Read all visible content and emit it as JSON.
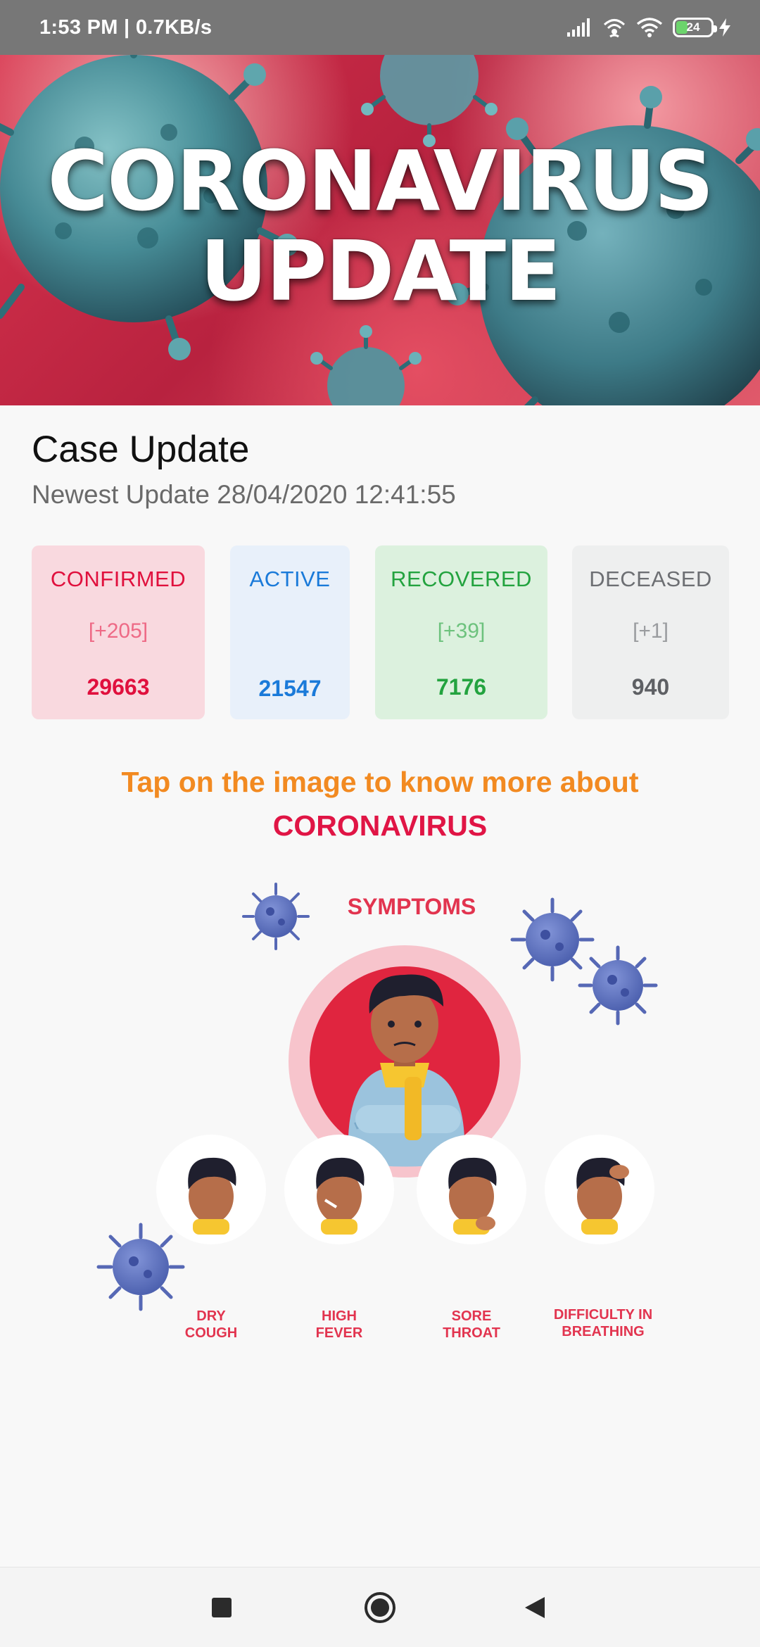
{
  "status_bar": {
    "time": "1:53 PM | 0.7KB/s",
    "battery": "24"
  },
  "banner": {
    "line1": "CORONAVIRUS",
    "line2": "UPDATE"
  },
  "case_update": {
    "title": "Case Update",
    "subtitle": "Newest Update 28/04/2020 12:41:55",
    "cards": [
      {
        "label": "CONFIRMED",
        "delta": "[+205]",
        "value": "29663",
        "color": "#e0103d"
      },
      {
        "label": "ACTIVE",
        "delta": "",
        "value": "21547",
        "color": "#1a7ad9"
      },
      {
        "label": "RECOVERED",
        "delta": "[+39]",
        "value": "7176",
        "color": "#23a33f"
      },
      {
        "label": "DECEASED",
        "delta": "[+1]",
        "value": "940",
        "color": "#6d6f73"
      }
    ]
  },
  "prompt": {
    "line1": "Tap on the image to know more about",
    "line2": "CORONAVIRUS"
  },
  "infographic": {
    "title": "SYMPTOMS",
    "items": [
      {
        "line1": "DRY",
        "line2": "COUGH"
      },
      {
        "line1": "HIGH",
        "line2": "FEVER"
      },
      {
        "line1": "SORE",
        "line2": "THROAT"
      },
      {
        "line1": "DIFFICULTY IN",
        "line2": "BREATHING"
      }
    ]
  },
  "nav": {
    "icons": [
      "recents-square-icon",
      "home-circle-icon",
      "back-triangle-icon"
    ]
  }
}
